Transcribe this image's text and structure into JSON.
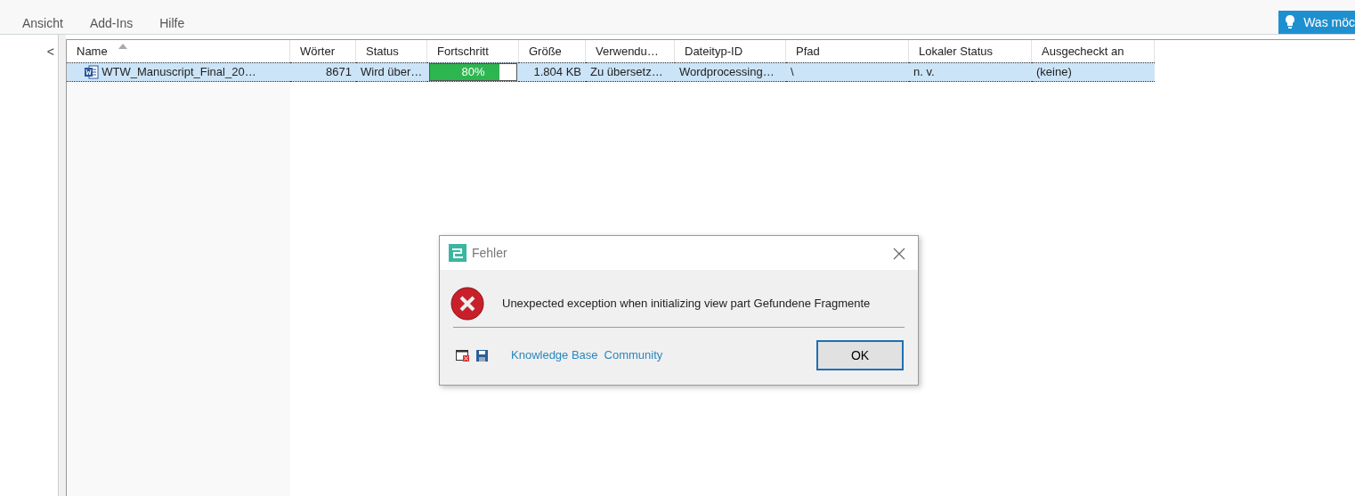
{
  "menu": [
    {
      "label": "Ansicht"
    },
    {
      "label": "Add-Ins"
    },
    {
      "label": "Hilfe"
    }
  ],
  "tell_me": {
    "label": "Was möc"
  },
  "sidebar": {
    "collapse": "<"
  },
  "table": {
    "columns": [
      {
        "label": "Name",
        "sorted": true
      },
      {
        "label": "Wörter",
        "sorted": false
      },
      {
        "label": "Status",
        "sorted": false
      },
      {
        "label": "Fortschritt",
        "sorted": false
      },
      {
        "label": "Größe",
        "sorted": false
      },
      {
        "label": "Verwendu…",
        "sorted": false
      },
      {
        "label": "Dateityp-ID",
        "sorted": false
      },
      {
        "label": "Pfad",
        "sorted": false
      },
      {
        "label": "Lokaler Status",
        "sorted": false
      },
      {
        "label": "Ausgecheckt an",
        "sorted": false
      }
    ],
    "rows": [
      {
        "selected": true,
        "name": "WTW_Manuscript_Final_20…",
        "words": "8671",
        "status": "Wird über…",
        "progress": {
          "level": 0.8,
          "label": "80%"
        },
        "size": "1.804 KB",
        "usage": "Zu übersetz…",
        "filetype": "Wordprocessing…",
        "path": "\\",
        "local_status": "n. v.",
        "checked_out": "(keine)"
      }
    ]
  },
  "dialog": {
    "title": "Fehler",
    "message": "Unexpected exception when initializing view part Gefundene Fragmente",
    "links": [
      {
        "label": "Knowledge Base"
      },
      {
        "label": "Community"
      }
    ],
    "button": "OK"
  }
}
